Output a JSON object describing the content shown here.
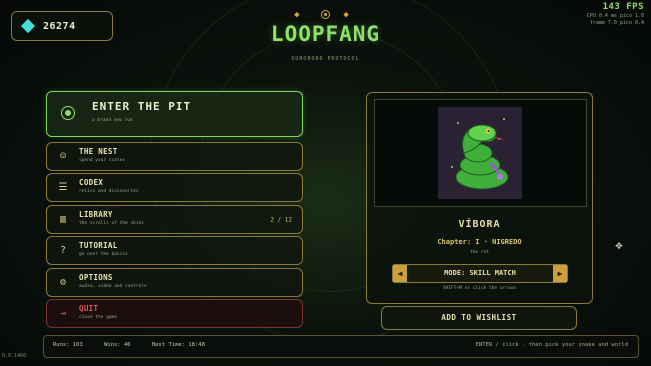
{
  "currency": {
    "amount": "26274",
    "icon": "gem-icon"
  },
  "title": "LOOPFANG",
  "subtitle": "OUROBORO PROTOCOL",
  "perf": {
    "fps": "143 FPS",
    "line1": "CPU 0.4 ms  pico 1.0",
    "line2": "frame 7.0  pico 0.4"
  },
  "enter": {
    "label": "ENTER THE PIT",
    "desc": "a brand new run"
  },
  "menu": [
    {
      "label": "THE NEST",
      "desc": "spend your scales",
      "icon": "nest-icon"
    },
    {
      "label": "CODEX",
      "desc": "relics and discoveries",
      "icon": "codex-icon"
    },
    {
      "label": "LIBRARY",
      "desc": "the scrolls of the skins",
      "count": "2 / 12",
      "icon": "library-icon"
    },
    {
      "label": "TUTORIAL",
      "desc": "go over the basics",
      "icon": "question-icon"
    },
    {
      "label": "OPTIONS",
      "desc": "audio, video and controls",
      "icon": "gear-icon"
    },
    {
      "label": "QUIT",
      "desc": "close the game",
      "icon": "exit-icon"
    }
  ],
  "character": {
    "name": "VÍBORA",
    "chapter": "Chapter: I · NIGREDO",
    "flavor": "the rot",
    "mode": "MODE: SKILL MATCH",
    "hint": "SHIFT+M or click the arrows"
  },
  "wishlist": "ADD TO WISHLIST",
  "stats": {
    "runs": "Runs: 103",
    "wins": "Wins: 46",
    "best": "Best Time: 18:48"
  },
  "controls_hint": "ENTER / click  ·  then pick your snake and world",
  "version": "0.0.1460",
  "colors": {
    "accent_green": "#8fe06a",
    "gold": "#caa13e",
    "quit_red": "#e05a5a",
    "gem": "#47e0d8"
  }
}
